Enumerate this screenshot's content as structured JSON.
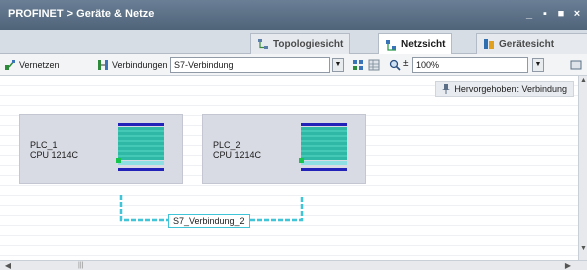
{
  "window": {
    "title": "PROFINET > Geräte & Netze",
    "controls": [
      "_",
      "▪",
      "■",
      "×"
    ]
  },
  "tabs": [
    {
      "label": "Topologiesicht",
      "active": false
    },
    {
      "label": "Netzsicht",
      "active": true
    },
    {
      "label": "Gerätesicht",
      "active": false
    }
  ],
  "toolbar": {
    "vernetzen_label": "Vernetzen",
    "verbindungen_label": "Verbindungen",
    "connection_type": "S7-Verbindung",
    "zoom": "100%"
  },
  "canvas": {
    "highlight_hint": "Hervorgehoben: Verbindung",
    "devices": [
      {
        "name": "PLC_1",
        "cpu": "CPU 1214C"
      },
      {
        "name": "PLC_2",
        "cpu": "CPU 1214C"
      }
    ],
    "connection_label": "S7_Verbindung_2"
  },
  "colors": {
    "title_bar": "#5a6f85",
    "device_bg": "#d9dbe4",
    "module_teal": "#2fb8a6",
    "rail_blue": "#2222b8",
    "connection": "#3fc4d8",
    "port_green": "#19c44e"
  }
}
